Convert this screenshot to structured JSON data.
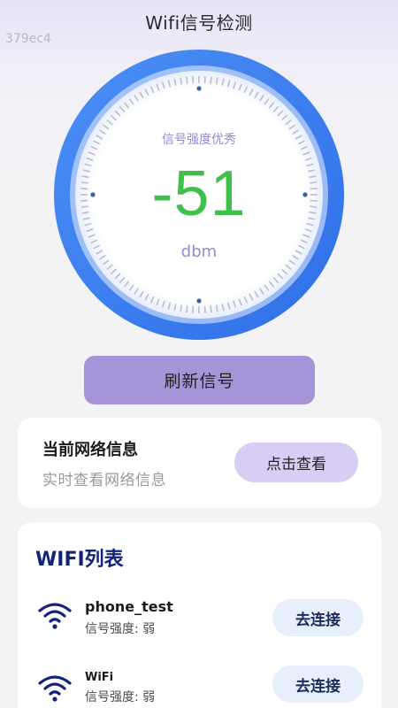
{
  "header": {
    "title": "Wifi信号检测"
  },
  "watermark": "379ec4",
  "gauge": {
    "quality_label": "信号强度优秀",
    "value": "-51",
    "unit": "dbm",
    "ring_color": "#3d7ff0",
    "value_color": "#3fc04b"
  },
  "refresh_button": {
    "label": "刷新信号"
  },
  "network_info": {
    "title": "当前网络信息",
    "subtitle": "实时查看网络信息",
    "view_button_label": "点击查看"
  },
  "wifi_list": {
    "title": "WIFI列表",
    "items": [
      {
        "name": "phone_test",
        "strength_label": "信号强度:",
        "strength_value": "弱",
        "connect_label": "去连接",
        "icon": "wifi-icon"
      },
      {
        "name": "WiFi",
        "strength_label": "信号强度:",
        "strength_value": "弱",
        "connect_label": "去连接",
        "icon": "wifi-icon"
      }
    ]
  }
}
